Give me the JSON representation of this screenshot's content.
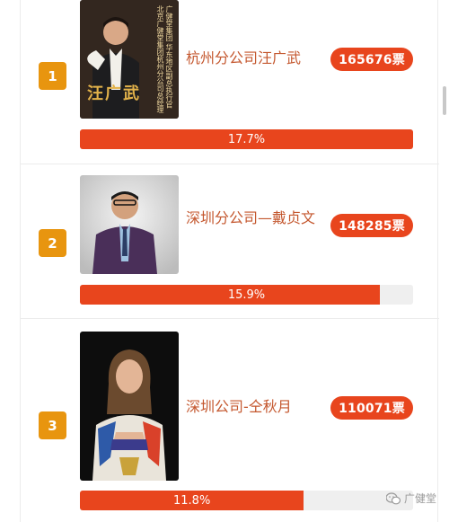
{
  "candidates": [
    {
      "rank": "1",
      "name": "杭州分公司汪广武",
      "votes": "165676票",
      "percent_label": "17.7%",
      "percent": 17.7,
      "bar_fill_ratio": 1.0,
      "photo_lines": [
        "广健堂集团 华东地区副总执行官",
        "北京广健堂集团杭州分公司总经理"
      ],
      "photo_name": "汪广武"
    },
    {
      "rank": "2",
      "name": "深圳分公司—戴贞文",
      "votes": "148285票",
      "percent_label": "15.9%",
      "percent": 15.9,
      "bar_fill_ratio": 0.9
    },
    {
      "rank": "3",
      "name": "深圳公司-仝秋月",
      "votes": "110071票",
      "percent_label": "11.8%",
      "percent": 11.8,
      "bar_fill_ratio": 0.67
    }
  ],
  "watermark": {
    "text": "广健堂",
    "icon": "wechat-icon"
  },
  "colors": {
    "accent": "#e8451d",
    "rank_badge": "#e8950f",
    "name_text": "#c4572e"
  }
}
